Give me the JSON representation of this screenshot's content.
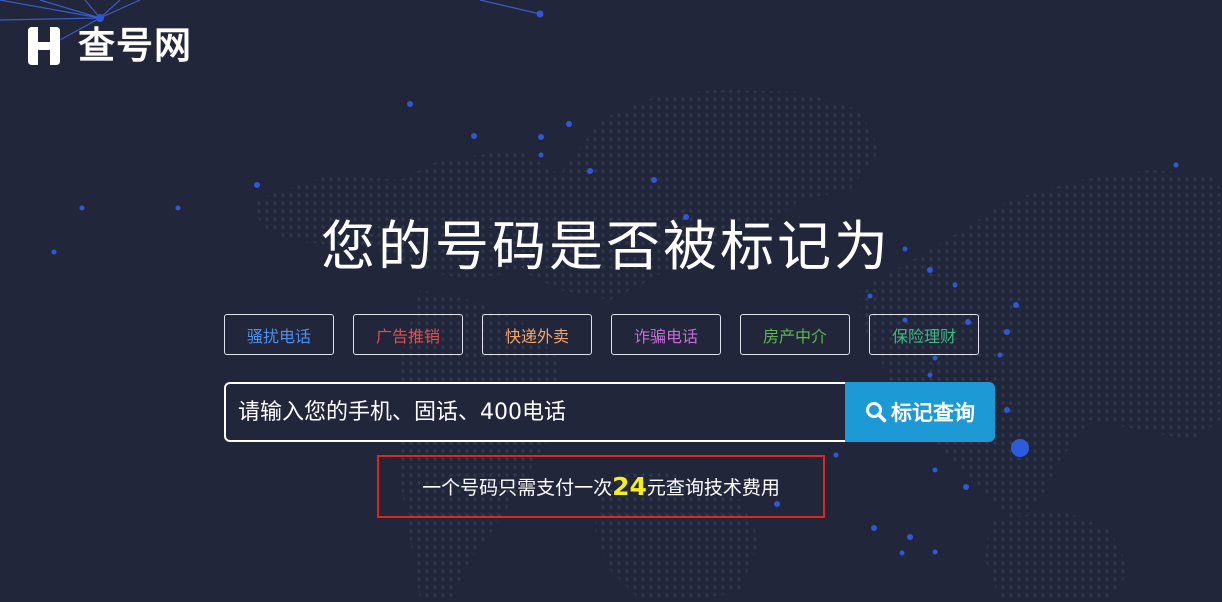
{
  "brand": {
    "name": "查号网",
    "logo_icon": "hexagon-h-logo-icon"
  },
  "hero": {
    "title": "您的号码是否被标记为"
  },
  "tags": [
    {
      "label": "骚扰电话",
      "color": "#4d8ff0"
    },
    {
      "label": "广告推销",
      "color": "#e04f4f"
    },
    {
      "label": "快递外卖",
      "color": "#f0a56a"
    },
    {
      "label": "诈骗电话",
      "color": "#c36bd6"
    },
    {
      "label": "房产中介",
      "color": "#5fb84a"
    },
    {
      "label": "保险理财",
      "color": "#41b883"
    }
  ],
  "search": {
    "placeholder": "请输入您的手机、固话、400电话",
    "button_label": "标记查询",
    "button_icon": "search-icon",
    "button_color": "#1d9ad6"
  },
  "notice": {
    "prefix": "一个号码只需支付一次",
    "price": "24",
    "suffix": "元查询技术费用",
    "price_color": "#f5ee1e",
    "border_color": "#e0261c"
  }
}
